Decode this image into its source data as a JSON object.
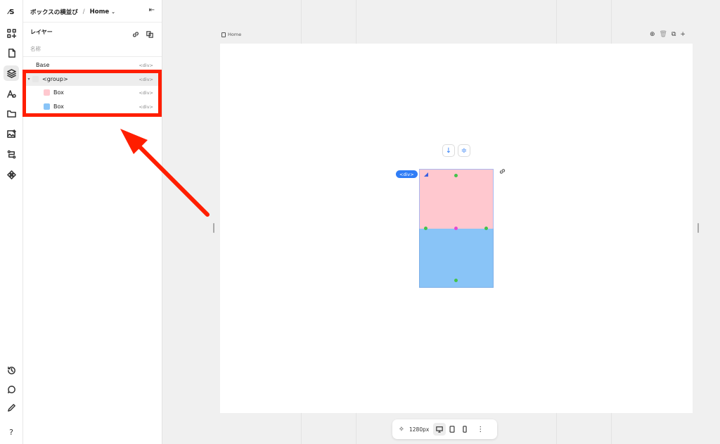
{
  "rail": {
    "logo": "⁄S",
    "top_icons": [
      "components-icon",
      "page-icon",
      "layers-icon",
      "assets-icon",
      "folder-icon",
      "media-icon",
      "flow-icon",
      "component-icon"
    ],
    "bottom_icons": [
      "history-icon",
      "comment-icon",
      "edit-icon",
      "help-icon"
    ],
    "help_label": "?"
  },
  "panel": {
    "project": "ボックスの横並び",
    "separator": "/",
    "page": "Home",
    "layers_title": "レイヤー",
    "column_name": "名称",
    "layers": [
      {
        "name": "Base",
        "tag": "<div>",
        "swatch": ""
      },
      {
        "name": "<group>",
        "tag": "<div>",
        "swatch": "#e6e6e6"
      },
      {
        "name": "Box",
        "tag": "<div>",
        "swatch": "#ffc8cf"
      },
      {
        "name": "Box",
        "tag": "<div>",
        "swatch": "#89c4f7"
      }
    ]
  },
  "canvas": {
    "frame_label": "Home",
    "selected_tag": "<div>",
    "pink_color": "#ffc8cf",
    "blue_color": "#89c4f7",
    "accent": "#2f7df6",
    "highlight_color": "#ff1e00"
  },
  "toolbar": {
    "width_label": "1280px",
    "more": "⋮"
  }
}
